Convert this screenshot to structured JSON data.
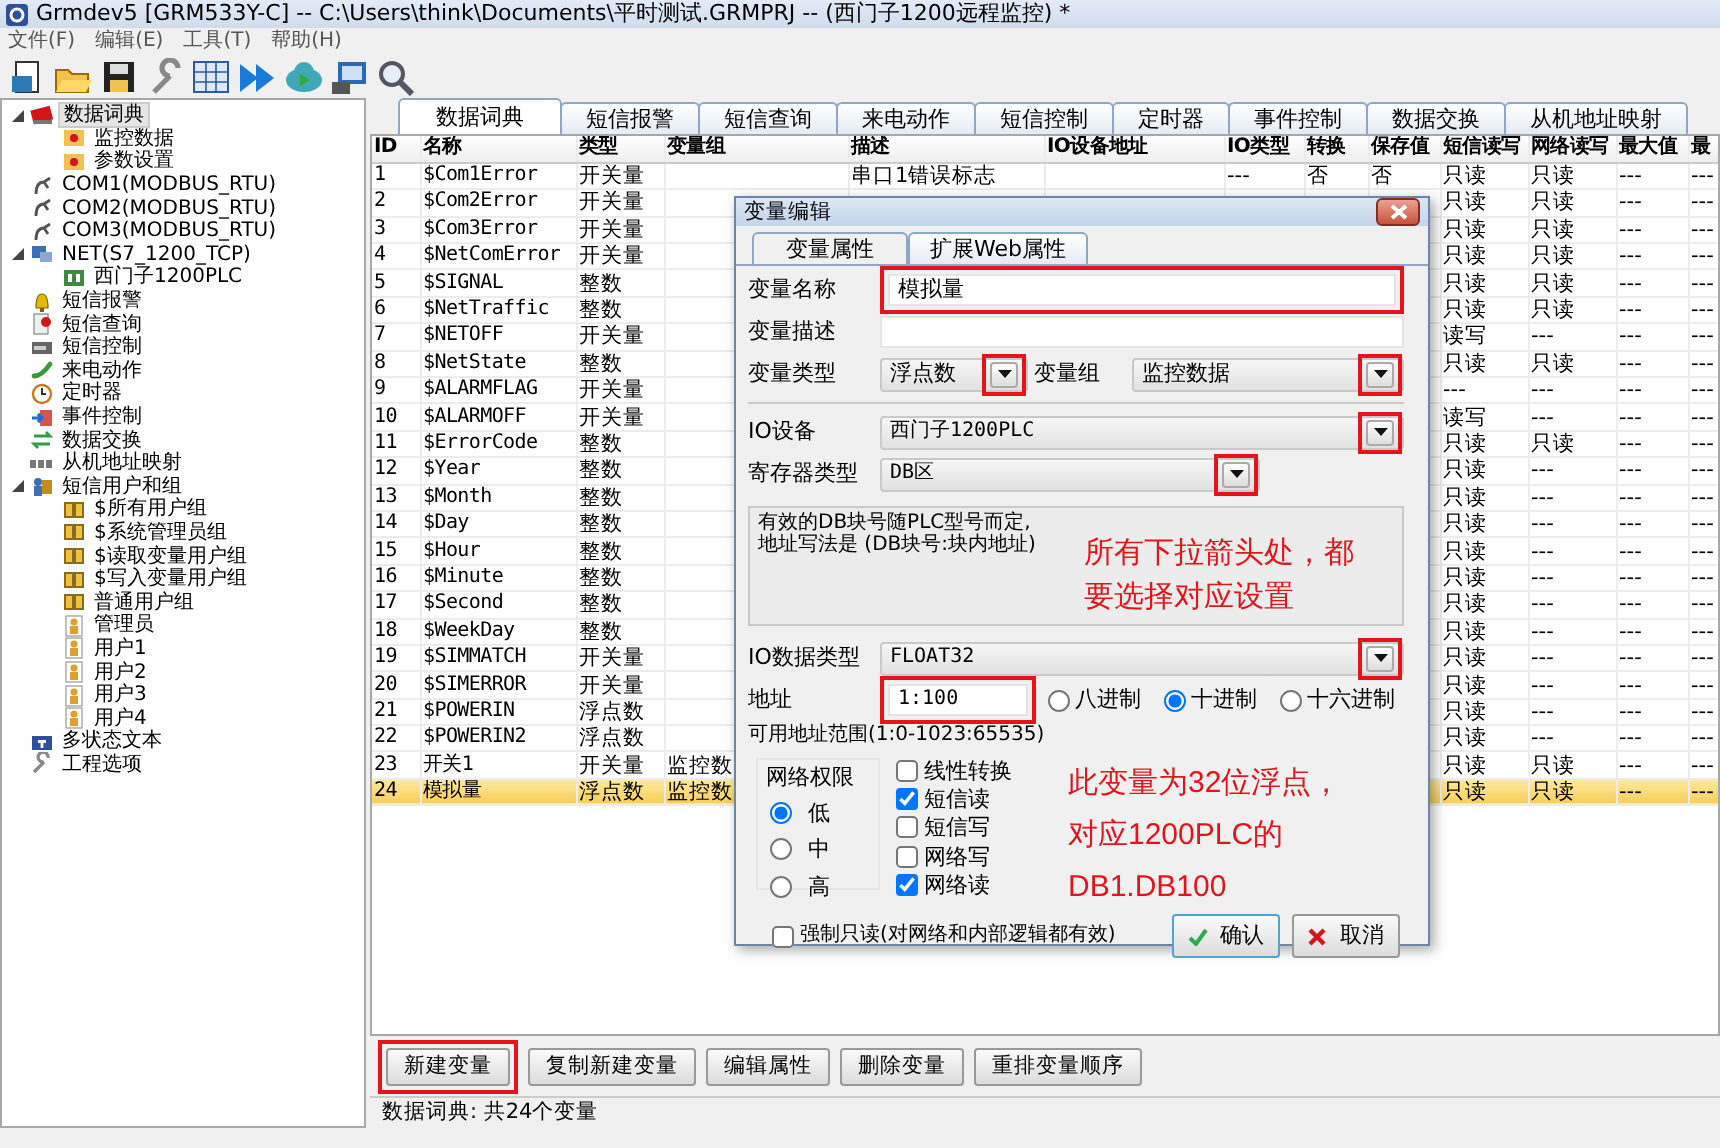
{
  "window": {
    "title": "Grmdev5 [GRM533Y-C]  -- C:\\Users\\think\\Documents\\平时测试.GRMPRJ -- (西门子1200远程监控) *"
  },
  "menu": [
    "文件(F)",
    "编辑(E)",
    "工具(T)",
    "帮助(H)"
  ],
  "toolbar": [
    {
      "kind": "new"
    },
    {
      "kind": "open"
    },
    {
      "kind": "save"
    },
    {
      "kind": "wrench"
    },
    {
      "kind": "grid"
    },
    {
      "kind": "run"
    },
    {
      "kind": "cloud"
    },
    {
      "kind": "monitor"
    },
    {
      "kind": "search"
    }
  ],
  "tree": [
    {
      "label": "数据词典",
      "kind": "book",
      "selected": true,
      "expanded": true,
      "children": [
        {
          "label": "监控数据",
          "kind": "folder",
          "selected": false
        },
        {
          "label": "参数设置",
          "kind": "folder",
          "selected": false
        }
      ]
    },
    {
      "label": "COM1(MODBUS_RTU)",
      "kind": "plug",
      "selected": false
    },
    {
      "label": "COM2(MODBUS_RTU)",
      "kind": "plug",
      "selected": false
    },
    {
      "label": "COM3(MODBUS_RTU)",
      "kind": "plug",
      "selected": false
    },
    {
      "label": "NET(S7_1200_TCP)",
      "kind": "network",
      "selected": false,
      "expanded": true,
      "children": [
        {
          "label": "西门子1200PLC",
          "kind": "plc",
          "selected": false
        }
      ]
    },
    {
      "label": "短信报警",
      "kind": "bell",
      "selected": false
    },
    {
      "label": "短信查询",
      "kind": "query",
      "selected": false
    },
    {
      "label": "短信控制",
      "kind": "sms",
      "selected": false
    },
    {
      "label": "来电动作",
      "kind": "phone",
      "selected": false
    },
    {
      "label": "定时器",
      "kind": "clock",
      "selected": false
    },
    {
      "label": "事件控制",
      "kind": "event",
      "selected": false
    },
    {
      "label": "数据交换",
      "kind": "exchange",
      "selected": false
    },
    {
      "label": "从机地址映射",
      "kind": "map",
      "selected": false
    },
    {
      "label": "短信用户和组",
      "kind": "users",
      "selected": false,
      "expanded": true,
      "children": [
        {
          "label": "$所有用户组",
          "kind": "group",
          "selected": false
        },
        {
          "label": "$系统管理员组",
          "kind": "group",
          "selected": false
        },
        {
          "label": "$读取变量用户组",
          "kind": "group",
          "selected": false
        },
        {
          "label": "$写入变量用户组",
          "kind": "group",
          "selected": false
        },
        {
          "label": "普通用户组",
          "kind": "group",
          "selected": false
        },
        {
          "label": "管理员",
          "kind": "user",
          "selected": false
        },
        {
          "label": "用户1",
          "kind": "user",
          "selected": false
        },
        {
          "label": "用户2",
          "kind": "user",
          "selected": false
        },
        {
          "label": "用户3",
          "kind": "user",
          "selected": false
        },
        {
          "label": "用户4",
          "kind": "user",
          "selected": false
        }
      ]
    },
    {
      "label": "多状态文本",
      "kind": "text",
      "selected": false
    },
    {
      "label": "工程选项",
      "kind": "wrench",
      "selected": false
    }
  ],
  "tabs": [
    {
      "label": "数据词典",
      "selected": true
    },
    {
      "label": "短信报警",
      "selected": false
    },
    {
      "label": "短信查询",
      "selected": false
    },
    {
      "label": "来电动作",
      "selected": false
    },
    {
      "label": "短信控制",
      "selected": false
    },
    {
      "label": "定时器",
      "selected": false
    },
    {
      "label": "事件控制",
      "selected": false
    },
    {
      "label": "数据交换",
      "selected": false
    },
    {
      "label": "从机地址映射",
      "selected": false
    }
  ],
  "table": {
    "columns": [
      "ID",
      "名称",
      "类型",
      "变量组",
      "描述",
      "IO设备地址",
      "IO类型",
      "转换",
      "保存值",
      "短信读写",
      "网络读写",
      "最大值",
      "最"
    ],
    "rows": [
      {
        "id": "1",
        "name": "$Com1Error",
        "type": "开关量",
        "description": "串口1错误标志",
        "io_type": "---",
        "convert": "否",
        "retain": "否",
        "sms_rw": "只读",
        "net_rw": "只读",
        "max": "---",
        "min": "---",
        "selected": false
      },
      {
        "id": "2",
        "name": "$Com2Error",
        "type": "开关量",
        "sms_rw": "只读",
        "net_rw": "只读",
        "max": "---",
        "min": "---",
        "selected": false
      },
      {
        "id": "3",
        "name": "$Com3Error",
        "type": "开关量",
        "sms_rw": "只读",
        "net_rw": "只读",
        "max": "---",
        "min": "---",
        "selected": false
      },
      {
        "id": "4",
        "name": "$NetComError",
        "type": "开关量",
        "sms_rw": "只读",
        "net_rw": "只读",
        "max": "---",
        "min": "---",
        "selected": false
      },
      {
        "id": "5",
        "name": "$SIGNAL",
        "type": "整数",
        "sms_rw": "只读",
        "net_rw": "只读",
        "max": "---",
        "min": "---",
        "selected": false
      },
      {
        "id": "6",
        "name": "$NetTraffic",
        "type": "整数",
        "sms_rw": "只读",
        "net_rw": "只读",
        "max": "---",
        "min": "---",
        "selected": false
      },
      {
        "id": "7",
        "name": "$NETOFF",
        "type": "开关量",
        "sms_rw": "读写",
        "net_rw": "---",
        "max": "---",
        "min": "---",
        "selected": false
      },
      {
        "id": "8",
        "name": "$NetState",
        "type": "整数",
        "sms_rw": "只读",
        "net_rw": "只读",
        "max": "---",
        "min": "---",
        "selected": false
      },
      {
        "id": "9",
        "name": "$ALARMFLAG",
        "type": "开关量",
        "sms_rw": "---",
        "net_rw": "---",
        "max": "---",
        "min": "---",
        "selected": false
      },
      {
        "id": "10",
        "name": "$ALARMOFF",
        "type": "开关量",
        "sms_rw": "读写",
        "net_rw": "---",
        "max": "---",
        "min": "---",
        "selected": false
      },
      {
        "id": "11",
        "name": "$ErrorCode",
        "type": "整数",
        "sms_rw": "只读",
        "net_rw": "只读",
        "max": "---",
        "min": "---",
        "selected": false
      },
      {
        "id": "12",
        "name": "$Year",
        "type": "整数",
        "sms_rw": "只读",
        "net_rw": "---",
        "max": "---",
        "min": "---",
        "selected": false
      },
      {
        "id": "13",
        "name": "$Month",
        "type": "整数",
        "sms_rw": "只读",
        "net_rw": "---",
        "max": "---",
        "min": "---",
        "selected": false
      },
      {
        "id": "14",
        "name": "$Day",
        "type": "整数",
        "sms_rw": "只读",
        "net_rw": "---",
        "max": "---",
        "min": "---",
        "selected": false
      },
      {
        "id": "15",
        "name": "$Hour",
        "type": "整数",
        "sms_rw": "只读",
        "net_rw": "---",
        "max": "---",
        "min": "---",
        "selected": false
      },
      {
        "id": "16",
        "name": "$Minute",
        "type": "整数",
        "sms_rw": "只读",
        "net_rw": "---",
        "max": "---",
        "min": "---",
        "selected": false
      },
      {
        "id": "17",
        "name": "$Second",
        "type": "整数",
        "sms_rw": "只读",
        "net_rw": "---",
        "max": "---",
        "min": "---",
        "selected": false
      },
      {
        "id": "18",
        "name": "$WeekDay",
        "type": "整数",
        "sms_rw": "只读",
        "net_rw": "---",
        "max": "---",
        "min": "---",
        "selected": false
      },
      {
        "id": "19",
        "name": "$SIMMATCH",
        "type": "开关量",
        "sms_rw": "只读",
        "net_rw": "---",
        "max": "---",
        "min": "---",
        "selected": false
      },
      {
        "id": "20",
        "name": "$SIMERROR",
        "type": "开关量",
        "sms_rw": "只读",
        "net_rw": "---",
        "max": "---",
        "min": "---",
        "selected": false
      },
      {
        "id": "21",
        "name": "$POWERIN",
        "type": "浮点数",
        "sms_rw": "只读",
        "net_rw": "---",
        "max": "---",
        "min": "---",
        "selected": false
      },
      {
        "id": "22",
        "name": "$POWERIN2",
        "type": "浮点数",
        "sms_rw": "只读",
        "net_rw": "---",
        "max": "---",
        "min": "---",
        "selected": false
      },
      {
        "id": "23",
        "name": "开关1",
        "type": "开关量",
        "group": "监控数",
        "sms_rw": "只读",
        "net_rw": "只读",
        "max": "---",
        "min": "---",
        "selected": false
      },
      {
        "id": "24",
        "name": "模拟量",
        "type": "浮点数",
        "group": "监控数",
        "sms_rw": "只读",
        "net_rw": "只读",
        "max": "---",
        "min": "---",
        "selected": true
      }
    ]
  },
  "buttons": [
    {
      "label": "新建变量",
      "highlighted": true
    },
    {
      "label": "复制新建变量",
      "highlighted": false
    },
    {
      "label": "编辑属性",
      "highlighted": false
    },
    {
      "label": "删除变量",
      "highlighted": false
    },
    {
      "label": "重排变量顺序",
      "highlighted": false
    }
  ],
  "status_bar": "数据词典: 共24个变量",
  "dialog": {
    "title": "变量编辑",
    "tabs": [
      {
        "label": "变量属性",
        "selected": true
      },
      {
        "label": "扩展Web属性",
        "selected": false
      }
    ],
    "name": {
      "label": "变量名称",
      "value": "模拟量",
      "highlighted": true
    },
    "description": {
      "label": "变量描述"
    },
    "var_type": {
      "label": "变量类型",
      "value": "浮点数",
      "highlighted": true
    },
    "var_group": {
      "label": "变量组",
      "value": "监控数据",
      "highlighted": true
    },
    "io_device": {
      "label": "IO设备",
      "value": "西门子1200PLC",
      "highlighted": true
    },
    "register_type": {
      "label": "寄存器类型",
      "value": "DB区",
      "highlighted": true
    },
    "info": "有效的DB块号随PLC型号而定,\n地址写法是 (DB块号:块内地址)",
    "io_data_type": {
      "label": "IO数据类型",
      "value": "FLOAT32",
      "highlighted": true
    },
    "address": {
      "label": "地址",
      "value": "1:100",
      "highlighted": true
    },
    "radix": [
      {
        "label": "八进制",
        "selected": false
      },
      {
        "label": "十进制",
        "selected": true
      },
      {
        "label": "十六进制",
        "selected": false
      }
    ],
    "range": "可用地址范围(1:0-1023:65535)",
    "permission": {
      "label": "网络权限",
      "options": [
        {
          "label": "低",
          "selected": true
        },
        {
          "label": "中",
          "selected": false
        },
        {
          "label": "高",
          "selected": false
        }
      ]
    },
    "flags": [
      {
        "label": "线性转换",
        "checked": false
      },
      {
        "label": "短信读",
        "checked": true
      },
      {
        "label": "短信写",
        "checked": false
      },
      {
        "label": "网络写",
        "checked": false
      },
      {
        "label": "网络读",
        "checked": true
      }
    ],
    "read_only": {
      "label": "强制只读(对网络和内部逻辑都有效)",
      "checked": false
    },
    "ok": "确认",
    "cancel": "取消",
    "notes": [
      "所有下拉箭头处，都要选择对应设置",
      "此变量为32位浮点，对应1200PLC的DB1.DB100"
    ]
  }
}
